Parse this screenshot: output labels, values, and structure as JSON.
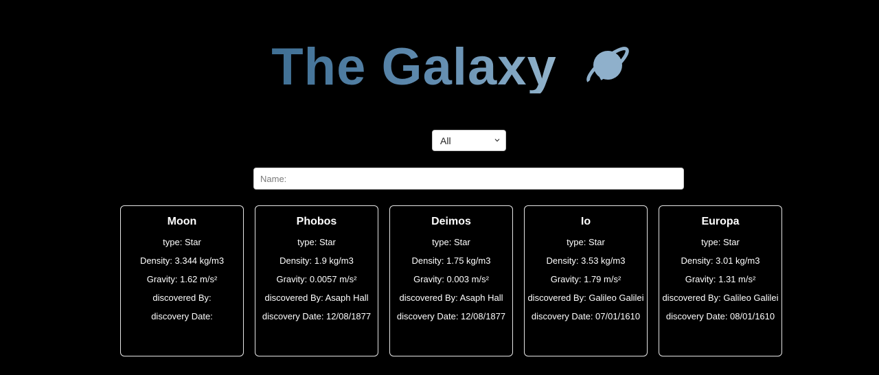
{
  "header": {
    "title": "The Galaxy",
    "logo_icon": "planet-icon",
    "title_gradient": [
      "#3f6f94",
      "#93b4cc"
    ]
  },
  "filter": {
    "selected": "All"
  },
  "search": {
    "placeholder": "Name:",
    "value": ""
  },
  "cards": [
    {
      "name": "Moon",
      "type": "type: Star",
      "density": "Density: 3.344 kg/m3",
      "gravity": "Gravity: 1.62 m/s²",
      "discovered_by": "discovered By:",
      "discovery_date": "discovery Date:"
    },
    {
      "name": "Phobos",
      "type": "type: Star",
      "density": "Density: 1.9 kg/m3",
      "gravity": "Gravity: 0.0057 m/s²",
      "discovered_by": "discovered By: Asaph Hall",
      "discovery_date": "discovery Date: 12/08/1877"
    },
    {
      "name": "Deimos",
      "type": "type: Star",
      "density": "Density: 1.75 kg/m3",
      "gravity": "Gravity: 0.003 m/s²",
      "discovered_by": "discovered By: Asaph Hall",
      "discovery_date": "discovery Date: 12/08/1877"
    },
    {
      "name": "Io",
      "type": "type: Star",
      "density": "Density: 3.53 kg/m3",
      "gravity": "Gravity: 1.79 m/s²",
      "discovered_by": "discovered By: Galileo Galilei",
      "discovery_date": "discovery Date: 07/01/1610"
    },
    {
      "name": "Europa",
      "type": "type: Star",
      "density": "Density: 3.01 kg/m3",
      "gravity": "Gravity: 1.31 m/s²",
      "discovered_by": "discovered By: Galileo Galilei",
      "discovery_date": "discovery Date: 08/01/1610"
    }
  ]
}
